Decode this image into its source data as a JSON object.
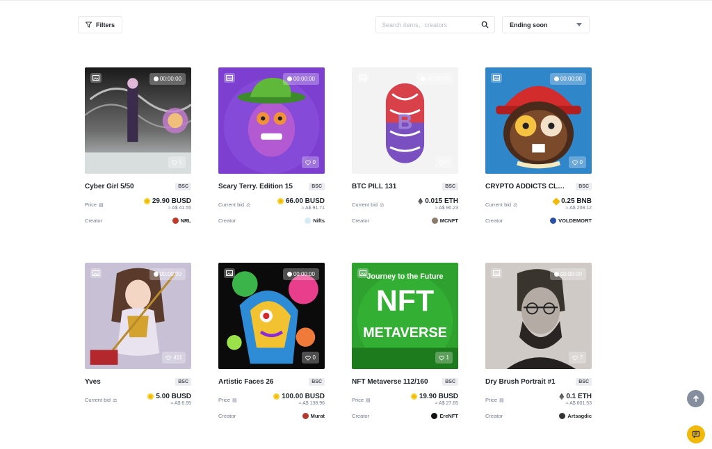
{
  "toolbar": {
    "filters_label": "Filters",
    "search_placeholder": "Search items、creators",
    "sort_selected": "Ending soon"
  },
  "colors": {
    "accent": "#f0b90b",
    "text_primary": "#1e2329",
    "text_secondary": "#707a8a",
    "border": "#e6e8ea"
  },
  "items": [
    {
      "title": "Cyber Girl 5/50",
      "chain": "BSC",
      "timer": "00:00:00",
      "likes": "1",
      "price_label": "Price",
      "price": "29.90 BUSD",
      "coin": "busd",
      "fiat": "≈ A$ 41.55",
      "creator_label": "Creator",
      "creator": "NRL",
      "avatar_color": "#c0392b",
      "art": "cyber"
    },
    {
      "title": "Scary Terry. Edition 15",
      "chain": "BSC",
      "timer": "00:00:00",
      "likes": "0",
      "price_label": "Current bid",
      "price": "66.00 BUSD",
      "coin": "busd",
      "fiat": "≈ A$ 91.71",
      "creator_label": "Creator",
      "creator": "Nifts",
      "avatar_color": "#d6ecf5",
      "art": "terry"
    },
    {
      "title": "BTC PILL 131",
      "chain": "BSC",
      "timer": "00:00:00",
      "likes": "2",
      "price_label": "Current bid",
      "price": "0.015 ETH",
      "coin": "eth",
      "fiat": "≈ A$ 90.23",
      "creator_label": "Creator",
      "creator": "MCNFT",
      "avatar_color": "#8d7b6a",
      "art": "pill"
    },
    {
      "title": "CRYPTO ADDICTS CLUB ...",
      "chain": "BSC",
      "timer": "00:00:00",
      "likes": "0",
      "price_label": "Current bid",
      "price": "0.25 BNB",
      "coin": "bnb",
      "fiat": "≈ A$ 208.12",
      "creator_label": "Creator",
      "creator": "VOLDEMORT",
      "avatar_color": "#2b4fa8",
      "art": "addict"
    },
    {
      "title": "Yves",
      "chain": "BSC",
      "timer": "00:00:00",
      "likes": "411",
      "price_label": "Current bid",
      "price": "5.00 BUSD",
      "coin": "busd",
      "fiat": "≈ A$ 6.95",
      "creator_label": "",
      "creator": "",
      "avatar_color": "",
      "art": "yves"
    },
    {
      "title": "Artistic Faces 26",
      "chain": "BSC",
      "timer": "00:00:00",
      "likes": "0",
      "price_label": "Price",
      "price": "100.00 BUSD",
      "coin": "busd",
      "fiat": "≈ A$ 138.96",
      "creator_label": "Creator",
      "creator": "Murat",
      "avatar_color": "#b03a2e",
      "art": "faces"
    },
    {
      "title": "NFT Metaverse 112/160",
      "chain": "BSC",
      "timer": "",
      "likes": "1",
      "price_label": "Price",
      "price": "19.90 BUSD",
      "coin": "busd",
      "fiat": "≈ A$ 27.65",
      "creator_label": "Creator",
      "creator": "EreNFT",
      "avatar_color": "#111111",
      "art": "metaverse",
      "art_text_top": "Journey to the Future",
      "art_text_mid": "NFT",
      "art_text_bottom": "METAVERSE"
    },
    {
      "title": "Dry Brush Portrait #1",
      "chain": "BSC",
      "timer": "00:00:00",
      "likes": "7",
      "price_label": "Price",
      "price": "0.1 ETH",
      "coin": "eth",
      "fiat": "≈ A$ 601.53",
      "creator_label": "Creator",
      "creator": "Artsagdic",
      "avatar_color": "#333333",
      "art": "portrait"
    }
  ],
  "floating": {
    "scroll_top_icon": "arrow-up-icon",
    "chat_icon": "chat-icon"
  }
}
